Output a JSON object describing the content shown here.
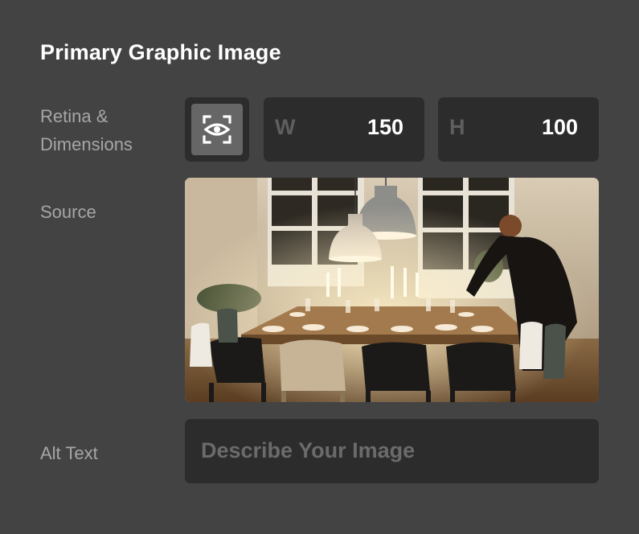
{
  "panel": {
    "title": "Primary Graphic Image"
  },
  "retina": {
    "label_line1": "Retina &",
    "label_line2": "Dimensions",
    "icon": "retina-scan-icon"
  },
  "width": {
    "prefix": "W",
    "value": "150"
  },
  "height": {
    "prefix": "H",
    "value": "100"
  },
  "source": {
    "label": "Source",
    "image_subject": "dinner-table-photo"
  },
  "alt_text": {
    "label": "Alt Text",
    "placeholder": "Describe Your Image"
  }
}
